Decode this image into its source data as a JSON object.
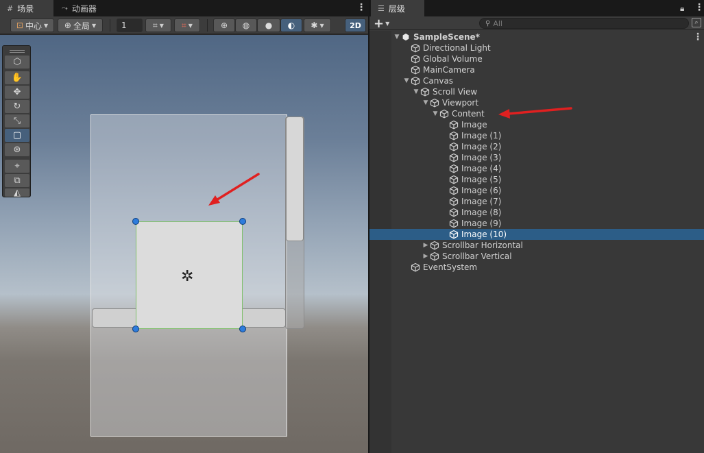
{
  "scene_panel": {
    "tabs": [
      {
        "icon": "grid-icon",
        "label": "场景"
      },
      {
        "icon": "animator-icon",
        "label": "动画器"
      }
    ],
    "toolbar": {
      "pivot_label": "中心",
      "space_label": "全局",
      "grid_value": "1",
      "mode_2d": "2D"
    },
    "tools": [
      "view-tool",
      "move-tool",
      "rotate-tool",
      "scale-tool",
      "rect-tool",
      "transform-tool",
      "custom-tool-1",
      "custom-tool-2",
      "custom-tool-3"
    ],
    "selected_tool": "rect-tool"
  },
  "hierarchy_panel": {
    "tab_label": "层级",
    "search_placeholder": "All",
    "add_label": "+",
    "items": [
      {
        "label": "SampleScene*",
        "depth": 0,
        "fold": "open",
        "type": "scene"
      },
      {
        "label": "Directional Light",
        "depth": 1,
        "fold": "none"
      },
      {
        "label": "Global Volume",
        "depth": 1,
        "fold": "none"
      },
      {
        "label": "MainCamera",
        "depth": 1,
        "fold": "none"
      },
      {
        "label": "Canvas",
        "depth": 1,
        "fold": "open"
      },
      {
        "label": "Scroll View",
        "depth": 2,
        "fold": "open"
      },
      {
        "label": "Viewport",
        "depth": 3,
        "fold": "open"
      },
      {
        "label": "Content",
        "depth": 4,
        "fold": "open"
      },
      {
        "label": "Image",
        "depth": 5,
        "fold": "none"
      },
      {
        "label": "Image (1)",
        "depth": 5,
        "fold": "none"
      },
      {
        "label": "Image (2)",
        "depth": 5,
        "fold": "none"
      },
      {
        "label": "Image (3)",
        "depth": 5,
        "fold": "none"
      },
      {
        "label": "Image (4)",
        "depth": 5,
        "fold": "none"
      },
      {
        "label": "Image (5)",
        "depth": 5,
        "fold": "none"
      },
      {
        "label": "Image (6)",
        "depth": 5,
        "fold": "none"
      },
      {
        "label": "Image (7)",
        "depth": 5,
        "fold": "none"
      },
      {
        "label": "Image (8)",
        "depth": 5,
        "fold": "none"
      },
      {
        "label": "Image (9)",
        "depth": 5,
        "fold": "none"
      },
      {
        "label": "Image (10)",
        "depth": 5,
        "fold": "none",
        "selected": true
      },
      {
        "label": "Scrollbar Horizontal",
        "depth": 3,
        "fold": "closed"
      },
      {
        "label": "Scrollbar Vertical",
        "depth": 3,
        "fold": "closed"
      },
      {
        "label": "EventSystem",
        "depth": 1,
        "fold": "none"
      }
    ]
  },
  "colors": {
    "selection": "#2c5d87",
    "annotation_arrow": "#e02020",
    "handle": "#2e7cdc",
    "rect_outline": "#7fbf6a"
  }
}
